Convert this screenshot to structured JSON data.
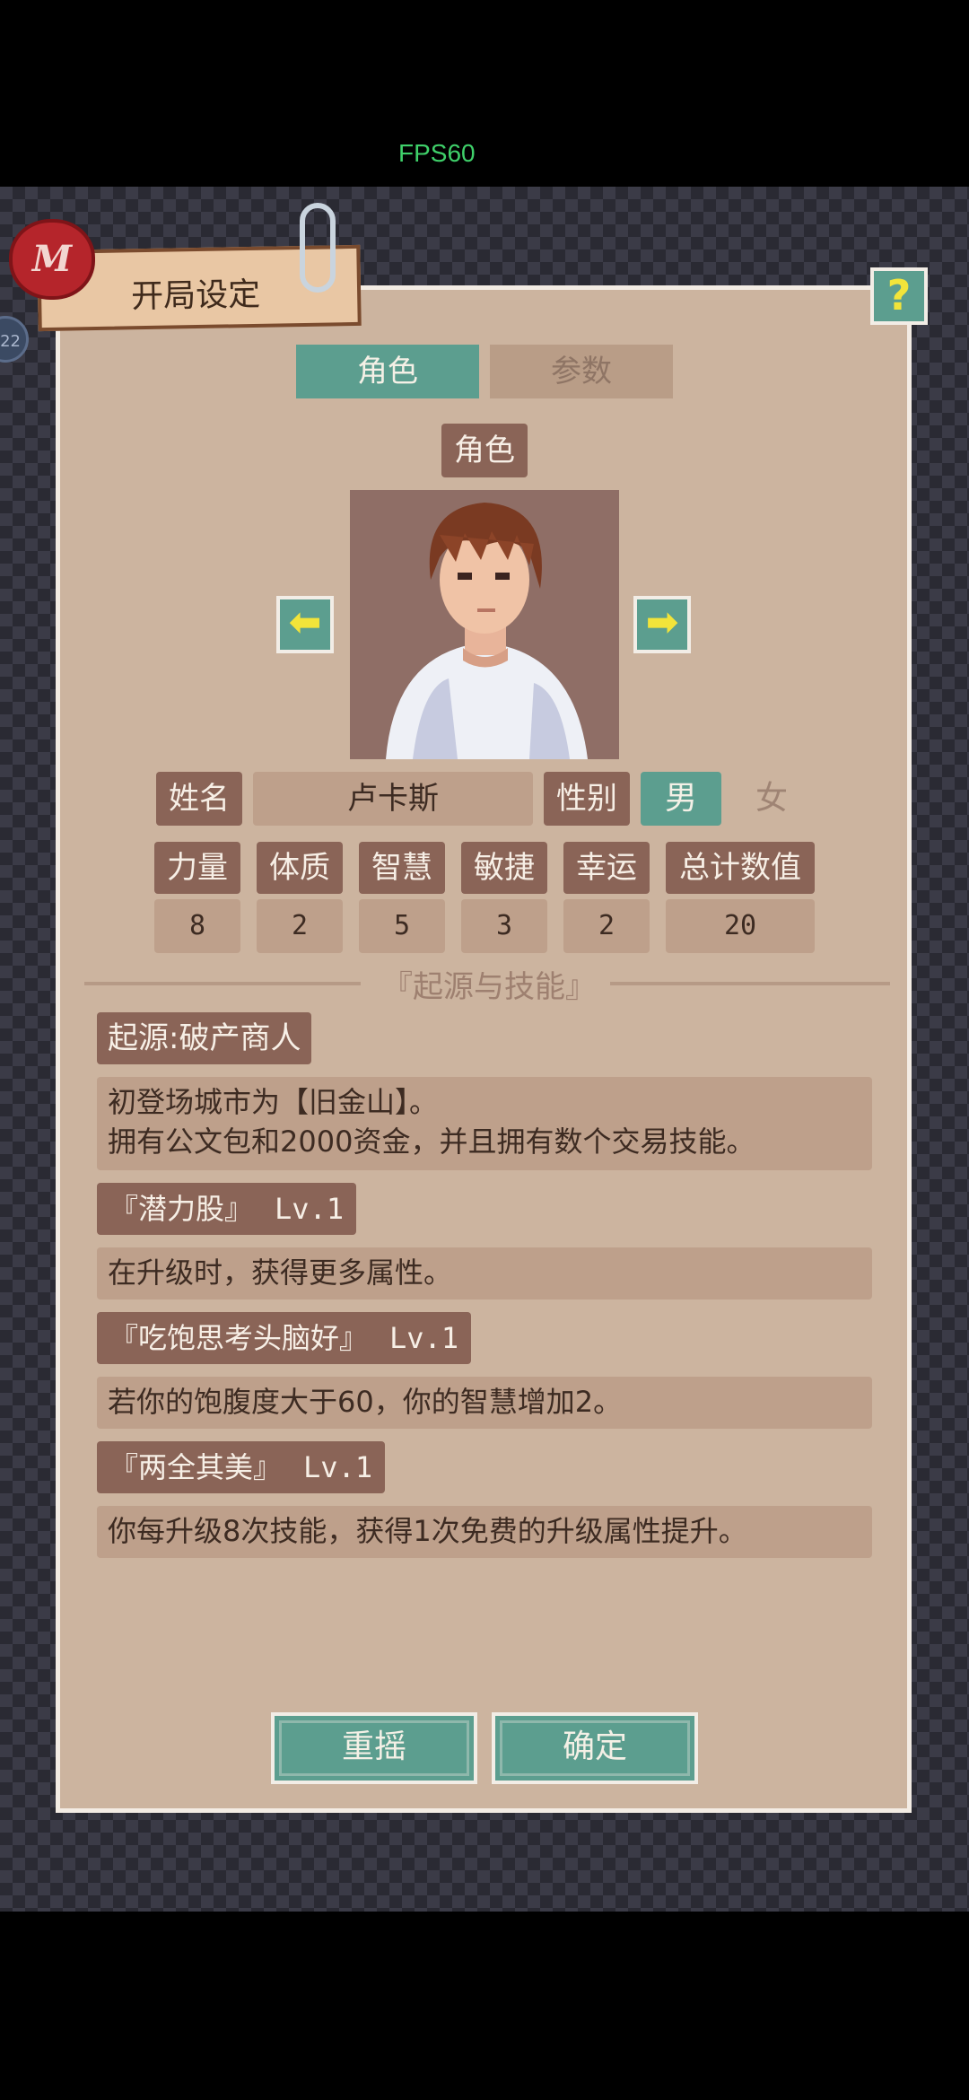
{
  "status": {
    "fps": "FPS60"
  },
  "side_badge": "22",
  "header": {
    "title": "开局设定",
    "seal": "M",
    "help": "?"
  },
  "tabs": [
    {
      "label": "角色",
      "active": true
    },
    {
      "label": "参数",
      "active": false
    }
  ],
  "character": {
    "section_label": "角色",
    "prev_icon": "arrow-left-icon",
    "next_icon": "arrow-right-icon",
    "name_label": "姓名",
    "name_value": "卢卡斯",
    "gender_label": "性别",
    "gender_male": "男",
    "gender_female": "女",
    "gender_selected": "男"
  },
  "stats": [
    {
      "label": "力量",
      "value": "8"
    },
    {
      "label": "体质",
      "value": "2"
    },
    {
      "label": "智慧",
      "value": "5"
    },
    {
      "label": "敏捷",
      "value": "3"
    },
    {
      "label": "幸运",
      "value": "2"
    },
    {
      "label": "总计数值",
      "value": "20"
    }
  ],
  "origin": {
    "heading": "『起源与技能』",
    "title": "起源:破产商人",
    "desc_line1": "初登场城市为【旧金山】。",
    "desc_line2": "拥有公文包和2000资金，并且拥有数个交易技能。"
  },
  "skills": [
    {
      "name": "『潜力股』",
      "level": "Lv.1",
      "desc": "在升级时，获得更多属性。"
    },
    {
      "name": "『吃饱思考头脑好』",
      "level": "Lv.1",
      "desc": "若你的饱腹度大于60，你的智慧增加2。"
    },
    {
      "name": "『两全其美』",
      "level": "Lv.1",
      "desc": "你每升级8次技能，获得1次免费的升级属性提升。"
    }
  ],
  "buttons": {
    "reroll": "重摇",
    "confirm": "确定"
  },
  "colors": {
    "accent": "#5c9e8f",
    "panel": "#ccb49f",
    "chip": "#8a6457",
    "field": "#bea08b"
  }
}
